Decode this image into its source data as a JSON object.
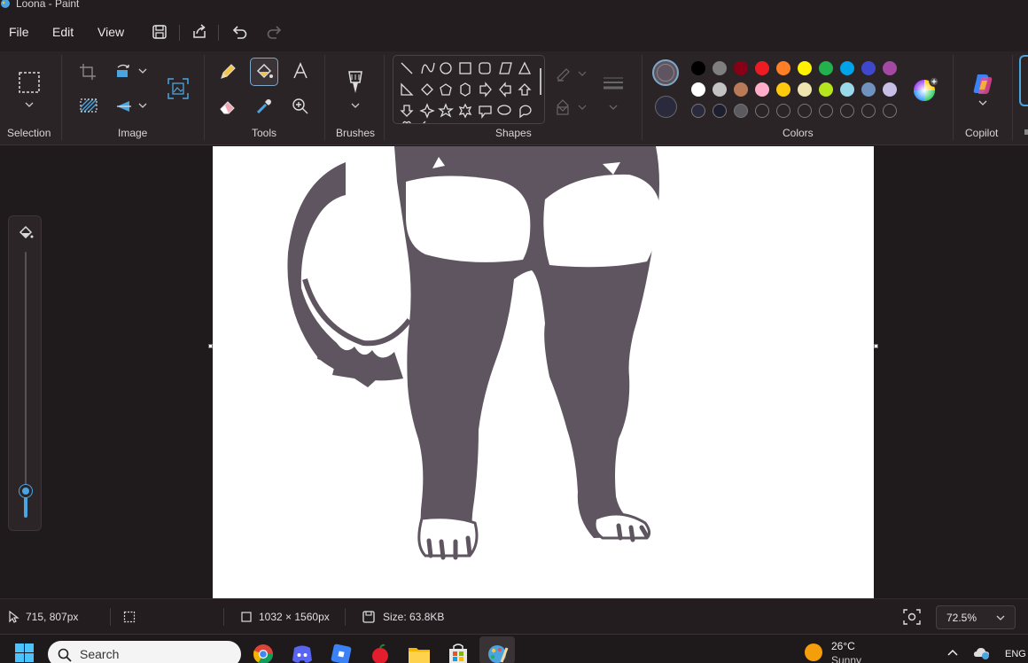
{
  "window": {
    "title": "Loona - Paint"
  },
  "menu": {
    "file": "File",
    "edit": "Edit",
    "view": "View"
  },
  "ribbon": {
    "groups": {
      "selection": "Selection",
      "image": "Image",
      "tools": "Tools",
      "brushes": "Brushes",
      "shapes": "Shapes",
      "colors": "Colors",
      "copilot": "Copilot"
    }
  },
  "colors": {
    "primary": "#5f5560",
    "secondary": "#2b2a3d",
    "palette_row1": [
      "#000000",
      "#7f7f7f",
      "#880015",
      "#ed1c24",
      "#ff7f27",
      "#fff200",
      "#22b14c",
      "#00a2e8",
      "#3f48cc",
      "#a349a4"
    ],
    "palette_row2": [
      "#ffffff",
      "#c3c3c3",
      "#b97a57",
      "#ffaec9",
      "#ffc90e",
      "#efe4b0",
      "#b5e61d",
      "#99d9ea",
      "#7092be",
      "#c8bfe7"
    ],
    "custom_row": [
      "#2b2a3d",
      "#1d1e30",
      "#5a5a5f",
      "",
      "",
      "",
      "",
      "",
      "",
      ""
    ]
  },
  "status": {
    "cursor_position": "715, 807px",
    "canvas_size": "1032 × 1560px",
    "file_size": "Size: 63.8KB",
    "zoom": "72.5%"
  },
  "brush_size_level": 0.1,
  "taskbar": {
    "search_placeholder": "Search",
    "weather_temp": "26°C",
    "weather_condition": "Sunny",
    "language": "ENG"
  }
}
